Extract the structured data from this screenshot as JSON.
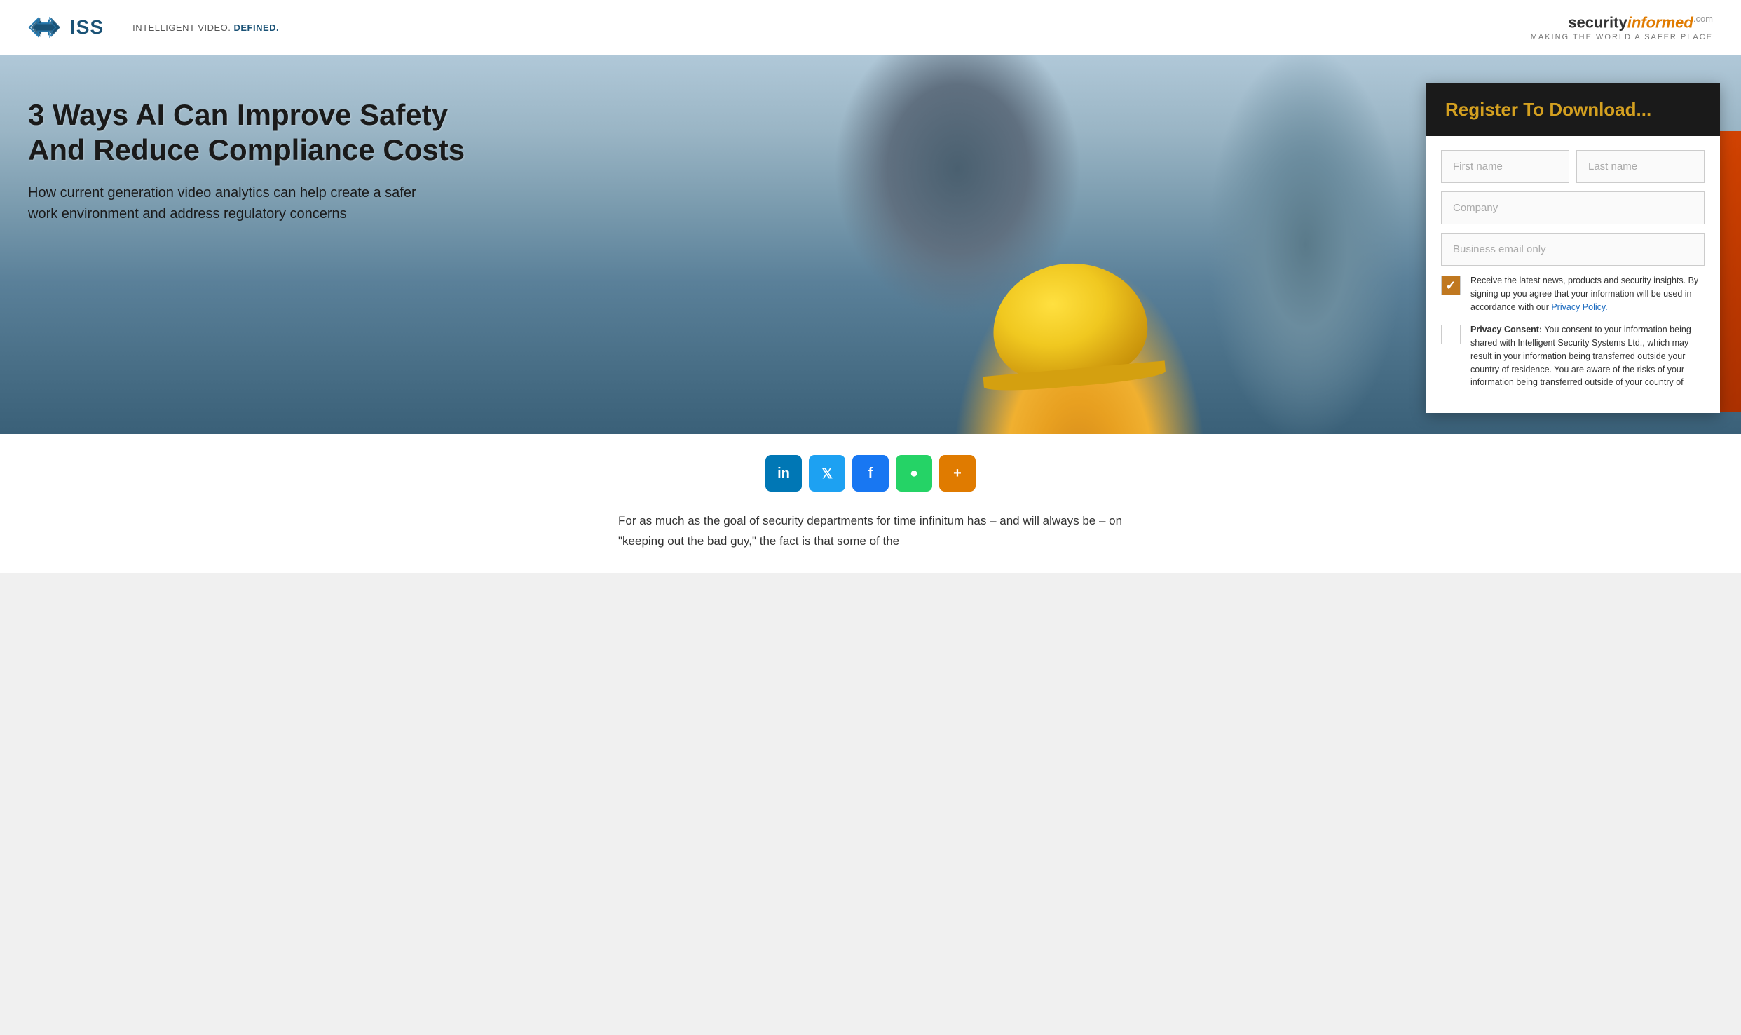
{
  "header": {
    "logo_left": {
      "brand": "ISS",
      "tagline_prefix": "INTELLIGENT VIDEO. ",
      "tagline_highlight": "DEFINED."
    },
    "logo_right": {
      "security": "security",
      "informed": "informed",
      "dotcom": ".com",
      "tagline": "Making The World A Safer Place"
    }
  },
  "hero": {
    "title": "3 Ways AI Can Improve Safety And Reduce Compliance Costs",
    "subtitle": "How current generation video analytics can help create a safer work environment and address regulatory concerns"
  },
  "form": {
    "header_title": "Register To Download...",
    "first_name_placeholder": "First name",
    "last_name_placeholder": "Last name",
    "company_placeholder": "Company",
    "email_placeholder": "Business email only",
    "checkbox1_text": "Receive the latest news, products and security insights. By signing up you agree that your information will be used in accordance with our ",
    "checkbox1_link": "Privacy Policy.",
    "checkbox2_bold": "Privacy Consent:",
    "checkbox2_text": " You consent to your information being shared with Intelligent Security Systems Ltd., which may result in your information being transferred outside your country of residence. You are aware of the risks of your information being transferred outside of your country of"
  },
  "social": {
    "buttons": [
      {
        "id": "linkedin",
        "icon": "in",
        "label": "LinkedIn"
      },
      {
        "id": "twitter",
        "icon": "𝕏",
        "label": "Twitter"
      },
      {
        "id": "facebook",
        "icon": "f",
        "label": "Facebook"
      },
      {
        "id": "whatsapp",
        "icon": "W",
        "label": "WhatsApp"
      },
      {
        "id": "plus",
        "icon": "+",
        "label": "Share More"
      }
    ]
  },
  "article": {
    "paragraph1": "For as much as the goal of security departments for time infinitum has – and will always be – on \"keeping out the bad guy,\" the fact is that some of the"
  }
}
